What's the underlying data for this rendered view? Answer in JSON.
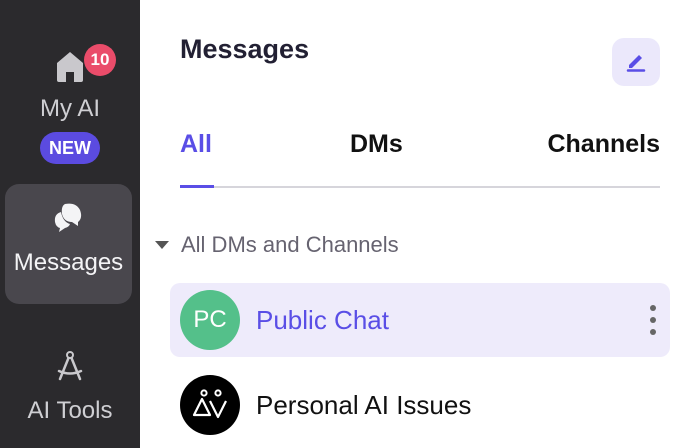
{
  "rail": {
    "home": {
      "label": "My AI",
      "count": "10",
      "badge": "NEW",
      "icon": "home-icon"
    },
    "messages": {
      "label": "Messages",
      "icon": "chat-bubbles-icon"
    },
    "tools": {
      "label": "AI Tools",
      "icon": "compass-tool-icon"
    }
  },
  "main": {
    "title": "Messages",
    "compose_icon": "edit-icon",
    "tabs": [
      {
        "label": "All",
        "active": true
      },
      {
        "label": "DMs",
        "active": false
      },
      {
        "label": "Channels",
        "active": false
      }
    ],
    "section": {
      "label": "All DMs and Channels",
      "icon": "caret-down-icon"
    },
    "rows": [
      {
        "initials": "PC",
        "name": "Public Chat",
        "avatar_color": "#54c08a",
        "selected": true
      },
      {
        "name": "Personal AI Issues",
        "avatar_icon": "personal-ai-logo-icon",
        "avatar_color": "#000000"
      }
    ]
  },
  "colors": {
    "accent": "#5a4ee6",
    "rail_bg": "#2b2a2d",
    "badge_red": "#ea4c6a",
    "selected_row": "#eeebfb"
  }
}
